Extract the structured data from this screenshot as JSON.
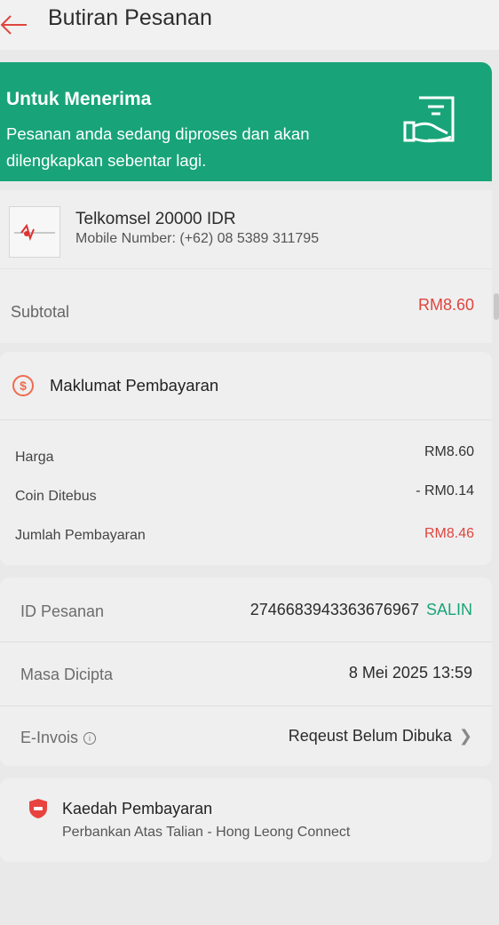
{
  "header": {
    "title": "Butiran Pesanan",
    "back_icon": "arrow-left-icon"
  },
  "banner": {
    "title": "Untuk Menerima",
    "message": "Pesanan anda sedang diproses dan akan dilengkapkan sebentar lagi.",
    "icon": "receipt-hand-icon",
    "color": "#18a478"
  },
  "product": {
    "name": "Telkomsel 20000 IDR",
    "mobile": "Mobile Number: (+62) 08 5389 311795",
    "icon": "telkomsel-logo-icon"
  },
  "subtotal": {
    "label": "Subtotal",
    "value": "RM8.60"
  },
  "payment_info": {
    "title": "Maklumat Pembayaran",
    "icon": "dollar-circle-icon",
    "rows": [
      {
        "label": "Harga",
        "value": "RM8.60"
      },
      {
        "label": "Coin Ditebus",
        "value": "- RM0.14"
      },
      {
        "label": "Jumlah Pembayaran",
        "value": "RM8.46"
      }
    ]
  },
  "order": {
    "id_label": "ID Pesanan",
    "id_value": "2746683943363676967",
    "copy_label": "SALIN",
    "created_label": "Masa Dicipta",
    "created_value": "8 Mei 2025 13:59",
    "einvoice_label": "E-Invois",
    "einvoice_value": "Reqeust Belum Dibuka",
    "info_icon": "info-circle-icon",
    "chevron_icon": "chevron-right-icon"
  },
  "payment_method": {
    "title": "Kaedah Pembayaran",
    "value": "Perbankan Atas Talian - Hong Leong Connect",
    "icon": "shield-icon"
  },
  "colors": {
    "accent": "#18a478",
    "price": "#e0443e"
  }
}
